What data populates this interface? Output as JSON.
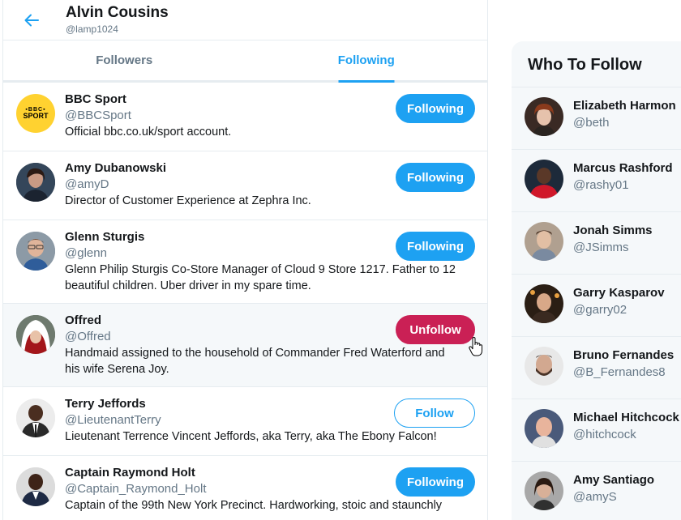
{
  "header": {
    "name": "Alvin Cousins",
    "handle": "@lamp1024"
  },
  "tabs": [
    {
      "label": "Followers",
      "active": false
    },
    {
      "label": "Following",
      "active": true
    }
  ],
  "users": [
    {
      "name": "BBC Sport",
      "handle": "@BBCSport",
      "bio": "Official bbc.co.uk/sport account.",
      "button": "Following",
      "avatar_text": "BBC SPORT"
    },
    {
      "name": "Amy Dubanowski",
      "handle": "@amyD",
      "bio": "Director of Customer Experience at Zephra Inc.",
      "button": "Following"
    },
    {
      "name": "Glenn Sturgis",
      "handle": "@glenn",
      "bio": "Glenn Philip Sturgis Co-Store Manager of Cloud 9 Store 1217. Father to 12 beautiful children. Uber driver in my spare time.",
      "button": "Following"
    },
    {
      "name": "Offred",
      "handle": "@Offred",
      "bio": "Handmaid assigned to the household of Commander Fred Waterford and his wife Serena Joy.",
      "button": "Unfollow"
    },
    {
      "name": "Terry Jeffords",
      "handle": "@LieutenantTerry",
      "bio": "Lieutenant Terrence Vincent Jeffords, aka Terry, aka The Ebony Falcon!",
      "button": "Follow"
    },
    {
      "name": "Captain Raymond Holt",
      "handle": "@Captain_Raymond_Holt",
      "bio": "Captain of the 99th New York Precinct. Hardworking, stoic and staunchly",
      "button": "Following"
    }
  ],
  "sidebar": {
    "title": "Who To Follow",
    "items": [
      {
        "name": "Elizabeth Harmon",
        "handle": "@beth"
      },
      {
        "name": "Marcus Rashford",
        "handle": "@rashy01"
      },
      {
        "name": "Jonah Simms",
        "handle": "@JSimms"
      },
      {
        "name": "Garry Kasparov",
        "handle": "@garry02"
      },
      {
        "name": "Bruno Fernandes",
        "handle": "@B_Fernandes8"
      },
      {
        "name": "Michael Hitchcock",
        "handle": "@hitchcock"
      },
      {
        "name": "Amy Santiago",
        "handle": "@amyS"
      }
    ]
  },
  "colors": {
    "accent": "#1da1f2",
    "unfollow": "#ca2055"
  },
  "icons": {
    "back": "arrow-left-icon",
    "cursor": "hand-pointer-icon"
  }
}
